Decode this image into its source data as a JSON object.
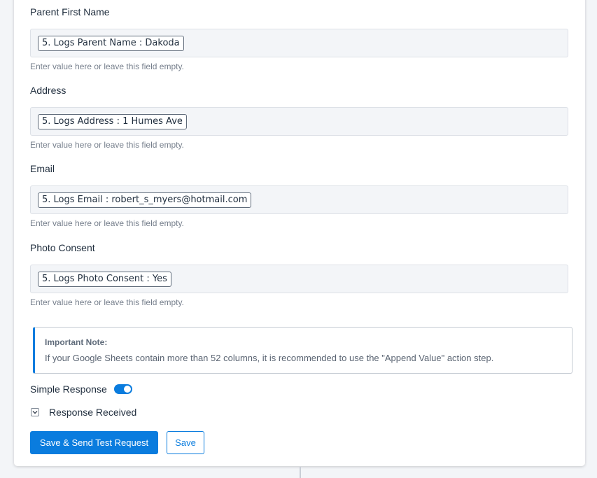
{
  "fields": [
    {
      "label": "Parent First Name",
      "value": "5. Logs Parent Name : Dakoda",
      "hint": "Enter value here or leave this field empty."
    },
    {
      "label": "Address",
      "value": "5. Logs Address : 1 Humes Ave",
      "hint": "Enter value here or leave this field empty."
    },
    {
      "label": "Email",
      "value": "5. Logs Email : robert_s_myers@hotmail.com",
      "hint": "Enter value here or leave this field empty."
    },
    {
      "label": "Photo Consent",
      "value": "5. Logs Photo Consent : Yes",
      "hint": "Enter value here or leave this field empty."
    }
  ],
  "note": {
    "title": "Important Note:",
    "text": "If your Google Sheets contain more than 52 columns, it is recommended to use the \"Append Value\" action step."
  },
  "simple_response": {
    "label": "Simple Response",
    "enabled": true
  },
  "response_received": {
    "label": "Response Received",
    "icon": "chevron-down-icon"
  },
  "buttons": {
    "save_send": "Save & Send Test Request",
    "save": "Save"
  },
  "colors": {
    "accent": "#0a7cde",
    "field_bg": "#f3f5f8",
    "text": "#1f2d3d",
    "hint": "#767f8c"
  }
}
